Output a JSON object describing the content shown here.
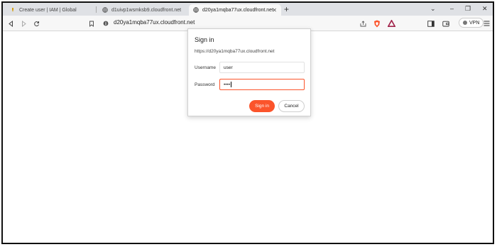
{
  "tabs": [
    {
      "title": "Create user | IAM | Global",
      "icon": "aws-icon",
      "active": false
    },
    {
      "title": "d1uivp1wsmksb9.cloudfront.net",
      "icon": "globe-icon",
      "active": false
    },
    {
      "title": "d20ya1mqba77ux.cloudfront.net",
      "icon": "globe-icon",
      "active": true
    }
  ],
  "toolbar": {
    "url": "d20ya1mqba77ux.cloudfront.net",
    "vpn_label": "VPN"
  },
  "dialog": {
    "title": "Sign in",
    "origin": "https://d20ya1mqba77ux.cloudfront.net",
    "username_label": "Username",
    "username_value": "user",
    "password_label": "Password",
    "password_value": "••••",
    "signin_label": "Sign in",
    "cancel_label": "Cancel"
  },
  "colors": {
    "accent": "#fb542b",
    "brave_shield": "#fb542b",
    "rewards": "#a1234a"
  }
}
